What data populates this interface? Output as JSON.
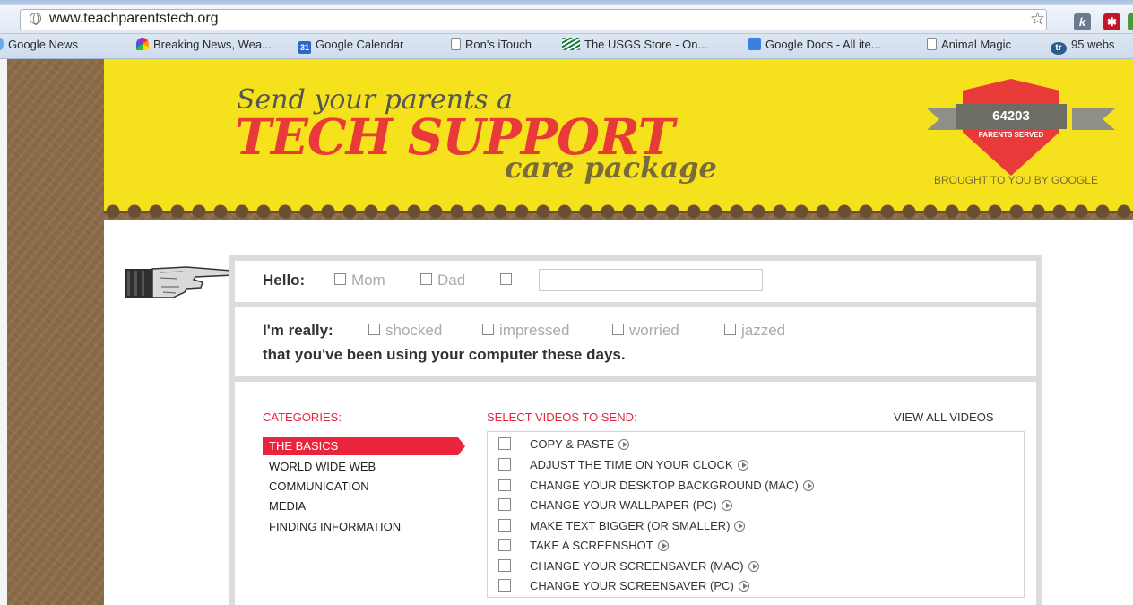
{
  "browser": {
    "url": "www.teachparentstech.org",
    "bookmarks": [
      {
        "label": "Google News",
        "icon": "news-icon"
      },
      {
        "label": "Breaking News, Wea...",
        "icon": "nbc-peacock-icon"
      },
      {
        "label": "Google Calendar",
        "icon": "calendar-icon",
        "icon_text": "31"
      },
      {
        "label": "Ron's iTouch",
        "icon": "page-icon"
      },
      {
        "label": "The USGS Store - On...",
        "icon": "usgs-icon"
      },
      {
        "label": "Google Docs - All ite...",
        "icon": "docs-icon"
      },
      {
        "label": "Animal Magic",
        "icon": "page-icon"
      },
      {
        "label": "95 webs",
        "icon": "tr-icon",
        "icon_text": "tr"
      }
    ],
    "ext_k": "k",
    "ext_x": "✱"
  },
  "banner": {
    "line1": "Send your parents a",
    "line2": "TECH SUPPORT",
    "line3": "care package",
    "counter": "64203",
    "counter_label": "PARENTS SERVED",
    "brought_by": "BROUGHT TO YOU BY GOOGLE"
  },
  "hello": {
    "label": "Hello:",
    "options": [
      "Mom",
      "Dad"
    ],
    "name_placeholder": ""
  },
  "really": {
    "label": "I'm really:",
    "options": [
      "shocked",
      "impressed",
      "worried",
      "jazzed"
    ],
    "tagline": "that you've been using your computer these days."
  },
  "categories": {
    "heading": "CATEGORIES:",
    "items": [
      "THE BASICS",
      "WORLD WIDE WEB",
      "COMMUNICATION",
      "MEDIA",
      "FINDING INFORMATION"
    ],
    "active": "THE BASICS"
  },
  "videos": {
    "heading": "SELECT VIDEOS TO SEND:",
    "view_all": "VIEW ALL VIDEOS",
    "items": [
      "COPY & PASTE",
      "ADJUST THE TIME ON YOUR CLOCK",
      "CHANGE YOUR DESKTOP BACKGROUND (MAC)",
      "CHANGE YOUR WALLPAPER (PC)",
      "MAKE TEXT BIGGER (OR SMALLER)",
      "TAKE A SCREENSHOT",
      "CHANGE YOUR SCREENSAVER (MAC)",
      "CHANGE YOUR SCREENSAVER (PC)"
    ]
  },
  "colors": {
    "banner_yellow": "#f6e21c",
    "accent_red": "#e93a3a",
    "heading_red": "#e9243c",
    "wood_brown": "#8b6a48"
  }
}
